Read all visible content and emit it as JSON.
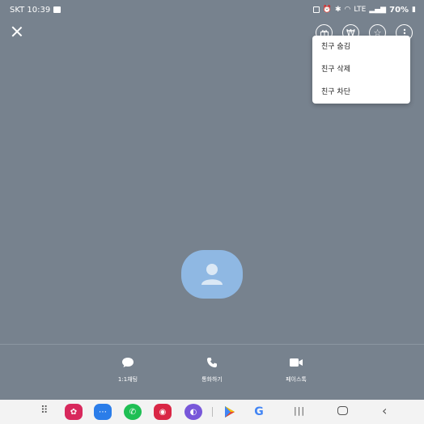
{
  "status": {
    "carrier_time": "SKT 10:39",
    "network": "LTE",
    "battery": "70%"
  },
  "menu": {
    "items": [
      {
        "label": "친구 숨김"
      },
      {
        "label": "친구 삭제"
      },
      {
        "label": "친구 차단"
      }
    ]
  },
  "top_actions": [
    {
      "icon": "gift-icon"
    },
    {
      "icon": "won-icon"
    },
    {
      "icon": "star-icon"
    },
    {
      "icon": "more-vertical-icon"
    }
  ],
  "actions": [
    {
      "label": "1:1채팅",
      "icon": "chat-icon"
    },
    {
      "label": "통화하기",
      "icon": "phone-icon"
    },
    {
      "label": "페이스톡",
      "icon": "video-icon"
    }
  ],
  "colors": {
    "background": "#77828e",
    "avatar": "#8fb8e3",
    "menu": "#ffffff"
  }
}
